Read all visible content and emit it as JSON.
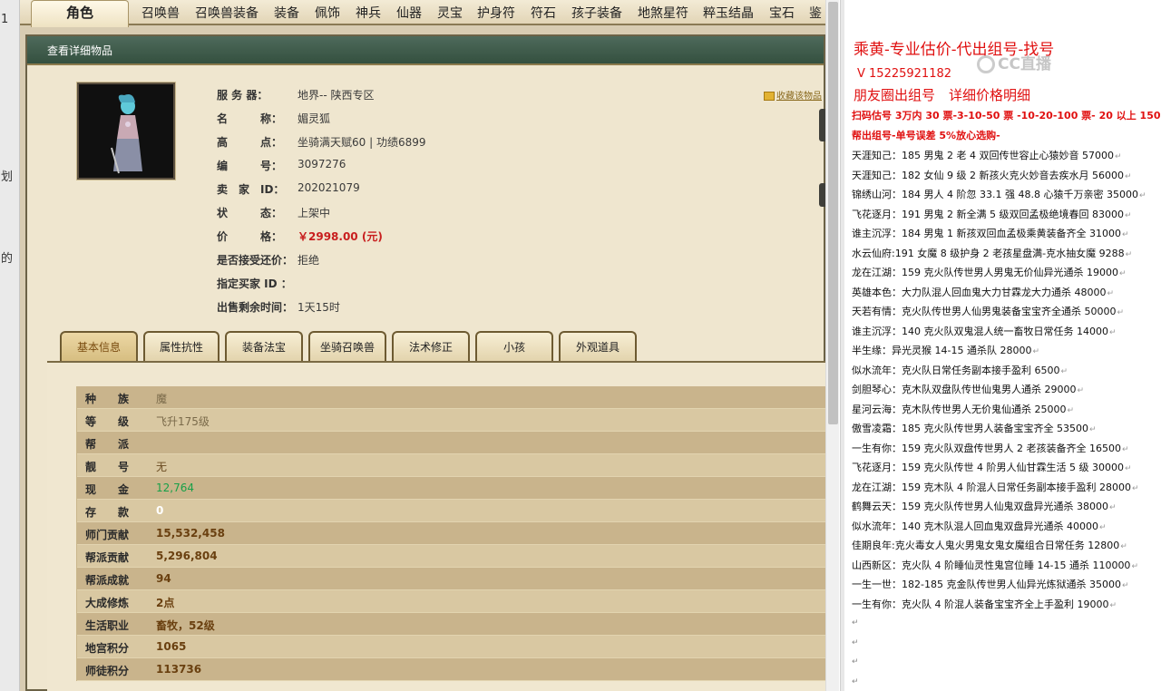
{
  "left_strip": {
    "fragments": [
      "1",
      "划",
      "的"
    ]
  },
  "top_nav": {
    "active_tab": "角色",
    "tabs": [
      "召唤兽",
      "召唤兽装备",
      "装备",
      "佩饰",
      "神兵",
      "仙器",
      "灵宝",
      "护身符",
      "符石",
      "孩子装备",
      "地煞星符",
      "粹玉结晶",
      "宝石",
      "鉴"
    ]
  },
  "window": {
    "title": "查看详细物品",
    "favorite_link": "收藏该物品",
    "info": [
      {
        "label": "服 务 器：",
        "value": "地界-- 陕西专区"
      },
      {
        "label": "名　　　称：",
        "value": "媚灵狐"
      },
      {
        "label": "高　　　点：",
        "value": "坐骑满天赋60 | 功绩6899"
      },
      {
        "label": "编　　　号：",
        "value": "3097276"
      },
      {
        "label": "卖　家　ID：",
        "value": "202021079"
      },
      {
        "label": "状　　　态：",
        "value": "上架中"
      },
      {
        "label": "价　　　格：",
        "value": "￥2998.00 (元)"
      },
      {
        "label": "是否接受还价：",
        "value": "拒绝"
      },
      {
        "label": "指定买家 ID ：",
        "value": ""
      },
      {
        "label": "出售剩余时间：",
        "value": "1天15时"
      }
    ],
    "sub_tabs": [
      "基本信息",
      "属性抗性",
      "装备法宝",
      "坐骑召唤兽",
      "法术修正",
      "小孩",
      "外观道具"
    ],
    "active_sub_tab": "基本信息",
    "attributes": [
      {
        "label": "种　　族",
        "value": "魔"
      },
      {
        "label": "等　　级",
        "value": "飞升175级"
      },
      {
        "label": "帮　　派",
        "value": ""
      },
      {
        "label": "靓　　号",
        "value": "无"
      },
      {
        "label": "现　　金",
        "value": "12,764"
      },
      {
        "label": "存　　款",
        "value": "0"
      },
      {
        "label": "师门贡献",
        "value": "15,532,458"
      },
      {
        "label": "帮派贡献",
        "value": "5,296,804"
      },
      {
        "label": "帮派成就",
        "value": "94"
      },
      {
        "label": "大成修炼",
        "value": "2点"
      },
      {
        "label": "生活职业",
        "value": "畜牧，52级"
      },
      {
        "label": "地宫积分",
        "value": "1065"
      },
      {
        "label": "师徒积分",
        "value": "113736"
      }
    ]
  },
  "doc": {
    "title": "乘黄-专业估价-代出组号-找号",
    "phone": "V 15225921182",
    "moments": "朋友圈出组号　详细价格明细",
    "watermark": "CC直播",
    "red_lines": [
      "扫码估号 3万内 30 票-3-10-50 票  -10-20-100 票- 20 以上 150",
      "帮出组号-单号误差 5%放心选购-"
    ],
    "lines": [
      "天涯知己：185 男鬼 2 老 4 双回传世容止心猿妙音 57000",
      "天涯知己：182 女仙 9 级 2 新孩火克火妙音去疾水月 56000",
      "锦绣山河：184 男人 4 阶忽 33.1 强 48.8 心猿千万亲密 35000",
      "飞花逐月：191 男鬼 2 新全满 5 级双回孟极绝境春回 83000",
      "谁主沉浮：184 男鬼 1 新孩双回血孟极乘黄装备齐全 31000",
      "水云仙府:191 女魔 8 级护身 2 老孩星盘满-克水抽女魔 9288",
      "龙在江湖：159 克火队传世男人男鬼无价仙异光通杀 19000",
      "英雄本色：大力队混人回血鬼大力甘霖龙大力通杀 48000",
      "天若有情：克火队传世男人仙男鬼装备宝宝齐全通杀 50000",
      "谁主沉浮：140 克火队双鬼混人统一畜牧日常任务 14000",
      "半生缘：异光灵猴 14-15 通杀队 28000",
      "似水流年：克火队日常任务副本接手盈利 6500",
      "剑胆琴心：克木队双盘队传世仙鬼男人通杀 29000",
      "星河云海：克木队传世男人无价鬼仙通杀 25000",
      "傲雪凌霜：185 克火队传世男人装备宝宝齐全 53500",
      "一生有你：159 克火队双盘传世男人 2 老孩装备齐全 16500",
      "飞花逐月：159 克火队传世 4 阶男人仙甘霖生活 5 级 30000",
      "龙在江湖：159 克木队 4 阶混人日常任务副本接手盈利 28000",
      "鹤舞云天：159 克火队传世男人仙鬼双盘异光通杀 38000",
      "似水流年：140 克木队混人回血鬼双盘异光通杀 40000",
      "佳期良年:克火毒女人鬼火男鬼女鬼女魔组合日常任务 12800",
      "山西新区：克火队 4 阶睡仙灵性鬼宫位睡 14-15 通杀 110000",
      "一生一世：182-185 克金队传世男人仙异光炼狱通杀 35000",
      "一生有你：克火队 4 阶混人装备宝宝齐全上手盈利 19000"
    ],
    "paragraph_mark": "↵"
  }
}
